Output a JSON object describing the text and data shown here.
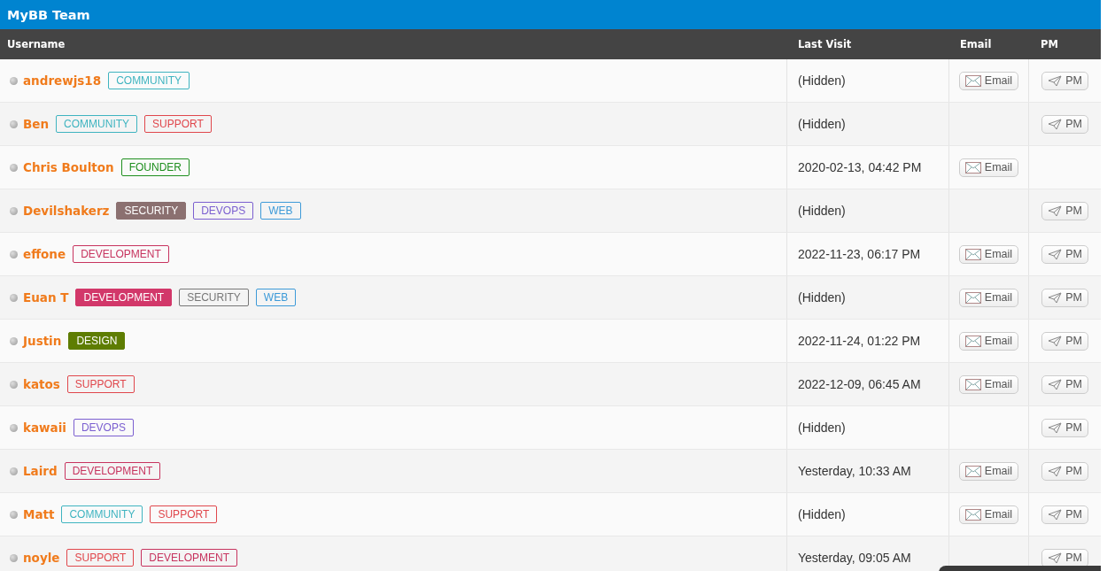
{
  "title": "MyBB Team",
  "columns": [
    "Username",
    "Last Visit",
    "Email",
    "PM"
  ],
  "rows": [
    {
      "username": "andrewjs18",
      "online": false,
      "groups": [
        {
          "label": "COMMUNITY",
          "color": "#3fb4c0",
          "filled": false
        }
      ],
      "last_visit": "(Hidden)",
      "email": "Email",
      "pm": "PM"
    },
    {
      "username": "Ben",
      "online": false,
      "groups": [
        {
          "label": "COMMUNITY",
          "color": "#3fb4c0",
          "filled": false
        },
        {
          "label": "SUPPORT",
          "color": "#e0474c",
          "filled": false
        }
      ],
      "last_visit": "(Hidden)",
      "pm": "PM"
    },
    {
      "username": "Chris Boulton",
      "online": false,
      "groups": [
        {
          "label": "FOUNDER",
          "color": "#1f8f1f",
          "filled": false
        }
      ],
      "last_visit": "2020-02-13, 04:42 PM",
      "email": "Email"
    },
    {
      "username": "Devilshakerz",
      "online": false,
      "groups": [
        {
          "label": "SECURITY",
          "color": "#8b7070",
          "filled": true
        },
        {
          "label": "DEVOPS",
          "color": "#7b5fd0",
          "filled": false
        },
        {
          "label": "WEB",
          "color": "#3d9ad8",
          "filled": false
        }
      ],
      "last_visit": "(Hidden)",
      "pm": "PM"
    },
    {
      "username": "effone",
      "online": false,
      "groups": [
        {
          "label": "DEVELOPMENT",
          "color": "#c7345f",
          "filled": false
        }
      ],
      "last_visit": "2022-11-23, 06:17 PM",
      "email": "Email",
      "pm": "PM"
    },
    {
      "username": "Euan T",
      "online": false,
      "groups": [
        {
          "label": "DEVELOPMENT",
          "color": "#d2386a",
          "filled": true
        },
        {
          "label": "SECURITY",
          "color": "#777777",
          "filled": false
        },
        {
          "label": "WEB",
          "color": "#3d9ad8",
          "filled": false
        }
      ],
      "last_visit": "(Hidden)",
      "email": "Email",
      "pm": "PM"
    },
    {
      "username": "Justin",
      "online": false,
      "groups": [
        {
          "label": "DESIGN",
          "color": "#5e7d02",
          "filled": true
        }
      ],
      "last_visit": "2022-11-24, 01:22 PM",
      "email": "Email",
      "pm": "PM"
    },
    {
      "username": "katos",
      "online": false,
      "groups": [
        {
          "label": "SUPPORT",
          "color": "#e0474c",
          "filled": false
        }
      ],
      "last_visit": "2022-12-09, 06:45 AM",
      "email": "Email",
      "pm": "PM"
    },
    {
      "username": "kawaii",
      "online": false,
      "groups": [
        {
          "label": "DEVOPS",
          "color": "#7b5fd0",
          "filled": false
        }
      ],
      "last_visit": "(Hidden)",
      "pm": "PM"
    },
    {
      "username": "Laird",
      "online": false,
      "groups": [
        {
          "label": "DEVELOPMENT",
          "color": "#c7345f",
          "filled": false
        }
      ],
      "last_visit": "Yesterday, 10:33 AM",
      "email": "Email",
      "pm": "PM"
    },
    {
      "username": "Matt",
      "online": false,
      "groups": [
        {
          "label": "COMMUNITY",
          "color": "#3fb4c0",
          "filled": false
        },
        {
          "label": "SUPPORT",
          "color": "#e0474c",
          "filled": false
        }
      ],
      "last_visit": "(Hidden)",
      "email": "Email",
      "pm": "PM"
    },
    {
      "username": "noyle",
      "online": false,
      "groups": [
        {
          "label": "SUPPORT",
          "color": "#e0474c",
          "filled": false
        },
        {
          "label": "DEVELOPMENT",
          "color": "#c7345f",
          "filled": false
        }
      ],
      "last_visit": "Yesterday, 09:05 AM",
      "pm": "PM"
    }
  ]
}
